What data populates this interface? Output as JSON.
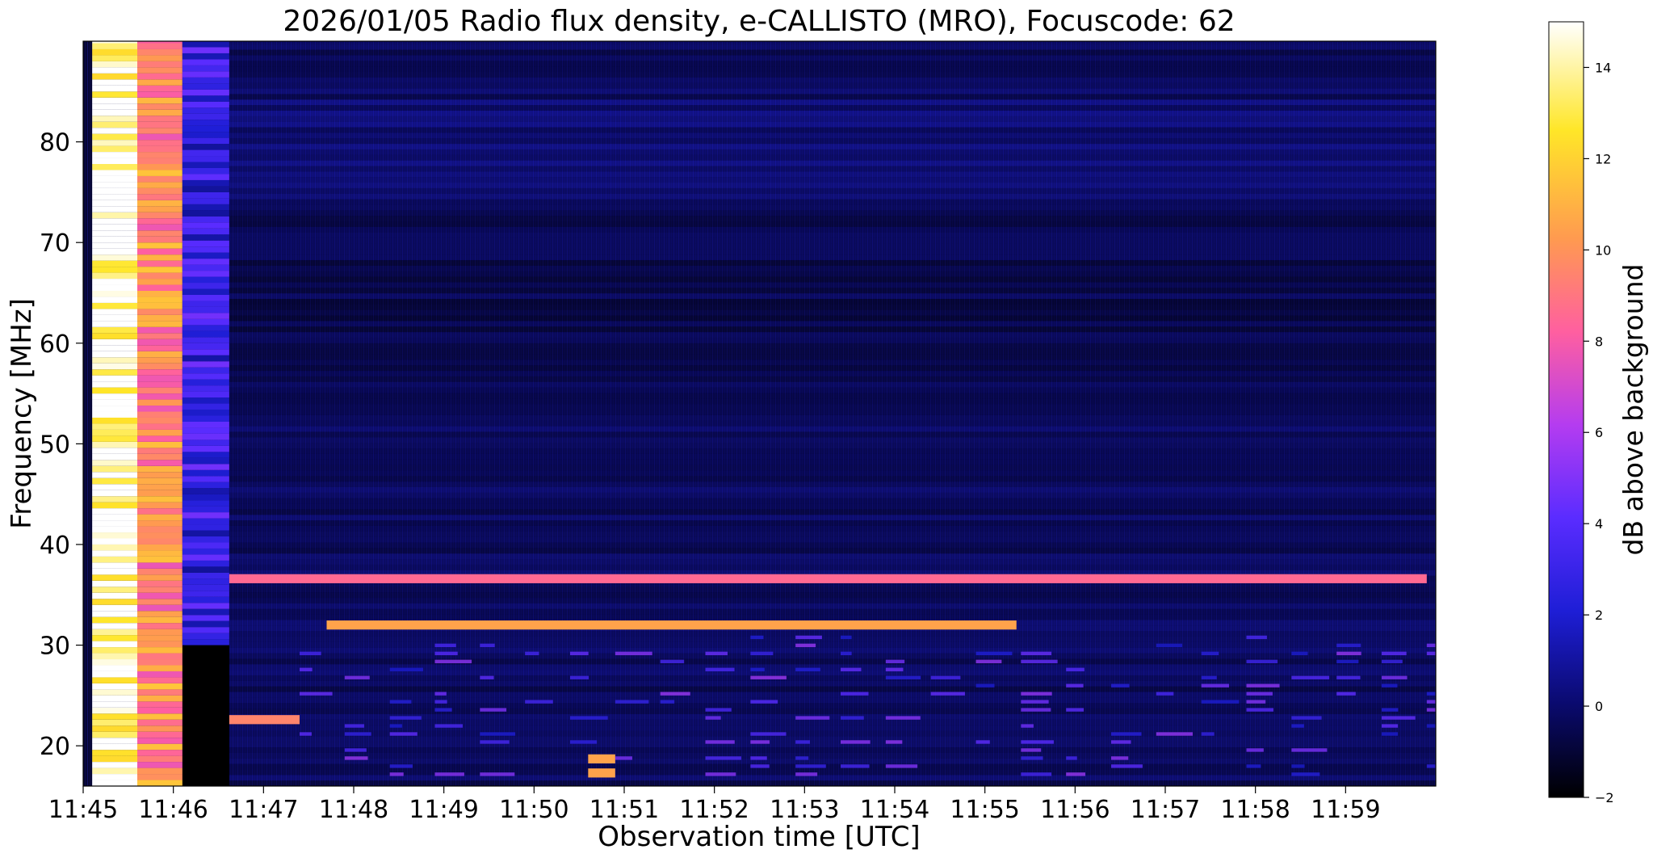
{
  "chart_data": {
    "type": "heatmap",
    "title": "2026/01/05  Radio flux density, e-CALLISTO (MRO), Focuscode: 62",
    "xlabel": "Observation time [UTC]",
    "ylabel": "Frequency [MHz]",
    "xlim": [
      "11:45",
      "11:60"
    ],
    "ylim": [
      16,
      90
    ],
    "x_ticks": [
      "11:45",
      "11:46",
      "11:47",
      "11:48",
      "11:49",
      "11:50",
      "11:51",
      "11:52",
      "11:53",
      "11:54",
      "11:55",
      "11:56",
      "11:57",
      "11:58",
      "11:59"
    ],
    "y_ticks": [
      20,
      30,
      40,
      50,
      60,
      70,
      80
    ],
    "colormap": "gnuplot2",
    "colorbar": {
      "label": "dB above background",
      "range": [
        -2,
        15
      ],
      "ticks": [
        -2,
        0,
        2,
        4,
        6,
        8,
        10,
        12,
        14
      ],
      "colors": [
        "#000000",
        "#0a0a6e",
        "#1e1ed6",
        "#5a2cff",
        "#b43cf0",
        "#ff5fa0",
        "#ff9a50",
        "#ffe628",
        "#ffffff"
      ]
    },
    "features": [
      {
        "kind": "broadband burst",
        "t_start": "11:45.10",
        "t_end": "11:45.60",
        "f_range": [
          16,
          90
        ],
        "db": 15
      },
      {
        "kind": "broadband burst",
        "t_start": "11:45.60",
        "t_end": "11:46.10",
        "f_range": [
          16,
          90
        ],
        "db": 10
      },
      {
        "kind": "broadband burst",
        "t_start": "11:46.10",
        "t_end": "11:46.62",
        "f_range": [
          30,
          90
        ],
        "db": 3
      },
      {
        "kind": "narrowband interference",
        "t_start": "11:47.70",
        "t_end": "11:55.35",
        "freq": 32.0,
        "db": 11
      },
      {
        "kind": "narrowband interference",
        "t_start": "11:46.62",
        "t_end": "11:59.90",
        "freq": 36.6,
        "db": 9
      },
      {
        "kind": "narrowband interference",
        "t_start": "11:46.62",
        "t_end": "11:47.40",
        "freq": 22.6,
        "db": 10
      },
      {
        "kind": "narrowband interference",
        "t_start": "11:50.60",
        "t_end": "11:50.90",
        "freq": 18.7,
        "db": 11
      },
      {
        "kind": "narrowband interference",
        "t_start": "11:50.60",
        "t_end": "11:50.90",
        "freq": 17.3,
        "db": 11
      }
    ]
  }
}
